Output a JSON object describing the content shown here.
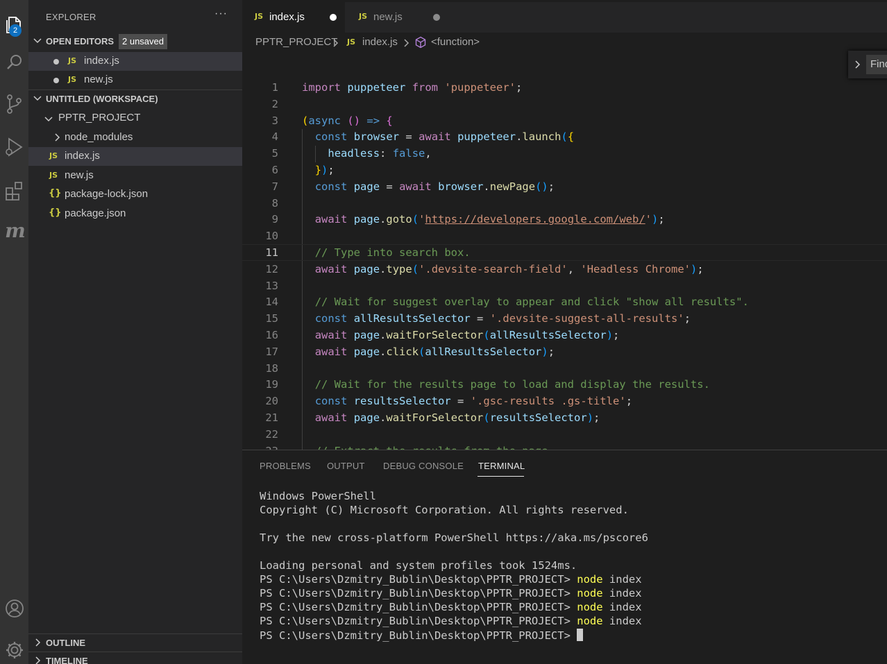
{
  "activity_bar": {
    "explorer_badge": "2",
    "items": [
      "files-icon",
      "search-icon",
      "source-control-icon",
      "run-debug-icon",
      "extensions-icon",
      "m-extension-icon",
      "account-icon",
      "gear-icon"
    ]
  },
  "sidebar": {
    "title": "EXPLORER",
    "more_actions": "···",
    "open_editors": {
      "label": "OPEN EDITORS",
      "badge": "2 unsaved",
      "files": [
        {
          "icon": "JS",
          "name": "index.js"
        },
        {
          "icon": "JS",
          "name": "new.js"
        }
      ]
    },
    "workspace": {
      "label": "UNTITLED (WORKSPACE)",
      "project": "PPTR_PROJECT",
      "items": [
        {
          "icon": ">",
          "name": "node_modules"
        },
        {
          "icon": "JS",
          "name": "index.js"
        },
        {
          "icon": "JS",
          "name": "new.js"
        },
        {
          "icon": "{}",
          "name": "package-lock.json"
        },
        {
          "icon": "{}",
          "name": "package.json"
        }
      ]
    },
    "outline_label": "OUTLINE",
    "timeline_label": "TIMELINE"
  },
  "editor": {
    "tabs": [
      {
        "icon": "JS",
        "name": "index.js",
        "active": true
      },
      {
        "icon": "JS",
        "name": "new.js",
        "active": false
      }
    ],
    "breadcrumb": {
      "project": "PPTR_PROJECT",
      "file_icon": "JS",
      "file": "index.js",
      "symbol": "<function>"
    },
    "find_placeholder": "Find",
    "current_line": 11,
    "lines": [
      {
        "n": "1",
        "text": "import puppeteer from 'puppeteer';"
      },
      {
        "n": "2",
        "text": ""
      },
      {
        "n": "3",
        "text": "(async () => {"
      },
      {
        "n": "4",
        "text": "  const browser = await puppeteer.launch({"
      },
      {
        "n": "5",
        "text": "    headless: false,"
      },
      {
        "n": "6",
        "text": "  });"
      },
      {
        "n": "7",
        "text": "  const page = await browser.newPage();"
      },
      {
        "n": "8",
        "text": ""
      },
      {
        "n": "9",
        "text": "  await page.goto('https://developers.google.com/web/');"
      },
      {
        "n": "10",
        "text": ""
      },
      {
        "n": "11",
        "text": "  // Type into search box."
      },
      {
        "n": "12",
        "text": "  await page.type('.devsite-search-field', 'Headless Chrome');"
      },
      {
        "n": "13",
        "text": ""
      },
      {
        "n": "14",
        "text": "  // Wait for suggest overlay to appear and click \"show all results\"."
      },
      {
        "n": "15",
        "text": "  const allResultsSelector = '.devsite-suggest-all-results';"
      },
      {
        "n": "16",
        "text": "  await page.waitForSelector(allResultsSelector);"
      },
      {
        "n": "17",
        "text": "  await page.click(allResultsSelector);"
      },
      {
        "n": "18",
        "text": ""
      },
      {
        "n": "19",
        "text": "  // Wait for the results page to load and display the results."
      },
      {
        "n": "20",
        "text": "  const resultsSelector = '.gsc-results .gs-title';"
      },
      {
        "n": "21",
        "text": "  await page.waitForSelector(resultsSelector);"
      },
      {
        "n": "22",
        "text": ""
      },
      {
        "n": "23",
        "text": "  // Extract the results from the page."
      }
    ]
  },
  "panel": {
    "tabs": [
      "PROBLEMS",
      "OUTPUT",
      "DEBUG CONSOLE",
      "TERMINAL"
    ],
    "active_tab": "TERMINAL",
    "terminal": {
      "lines": [
        "Windows PowerShell",
        "Copyright (C) Microsoft Corporation. All rights reserved.",
        "",
        "Try the new cross-platform PowerShell https://aka.ms/pscore6",
        "",
        "Loading personal and system profiles took 1524ms."
      ],
      "prompt": "PS C:\\Users\\Dzmitry_Bublin\\Desktop\\PPTR_PROJECT> ",
      "commands": [
        {
          "cmd": "node",
          "arg": " index"
        },
        {
          "cmd": "node",
          "arg": " index"
        },
        {
          "cmd": "node",
          "arg": " index"
        },
        {
          "cmd": "node",
          "arg": " index"
        }
      ]
    }
  },
  "colors": {
    "activity_bar": "#333333",
    "sidebar": "#252526",
    "editor": "#1e1e1e",
    "badge": "#0e70c0",
    "js_icon": "#cbcb41"
  }
}
